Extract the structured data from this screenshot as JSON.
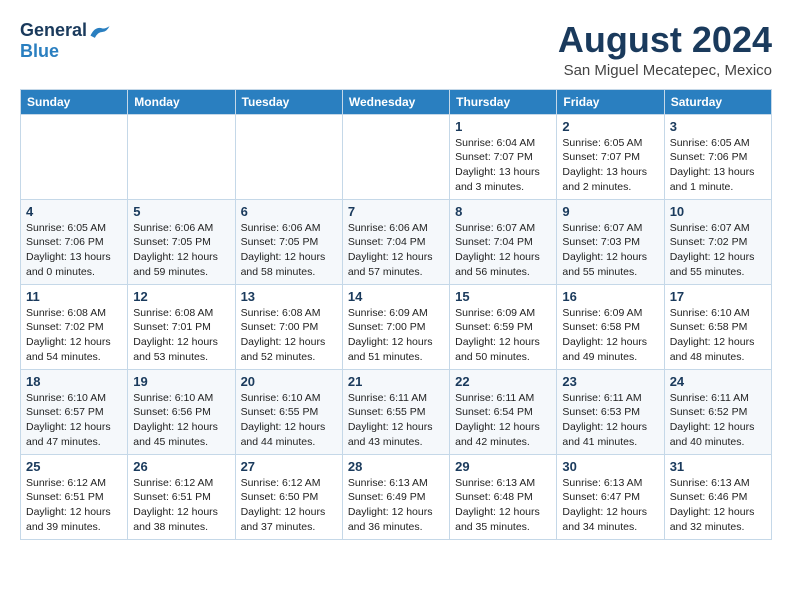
{
  "header": {
    "logo_general": "General",
    "logo_blue": "Blue",
    "month_year": "August 2024",
    "location": "San Miguel Mecatepec, Mexico"
  },
  "weekdays": [
    "Sunday",
    "Monday",
    "Tuesday",
    "Wednesday",
    "Thursday",
    "Friday",
    "Saturday"
  ],
  "weeks": [
    [
      {
        "day": "",
        "info": ""
      },
      {
        "day": "",
        "info": ""
      },
      {
        "day": "",
        "info": ""
      },
      {
        "day": "",
        "info": ""
      },
      {
        "day": "1",
        "info": "Sunrise: 6:04 AM\nSunset: 7:07 PM\nDaylight: 13 hours\nand 3 minutes."
      },
      {
        "day": "2",
        "info": "Sunrise: 6:05 AM\nSunset: 7:07 PM\nDaylight: 13 hours\nand 2 minutes."
      },
      {
        "day": "3",
        "info": "Sunrise: 6:05 AM\nSunset: 7:06 PM\nDaylight: 13 hours\nand 1 minute."
      }
    ],
    [
      {
        "day": "4",
        "info": "Sunrise: 6:05 AM\nSunset: 7:06 PM\nDaylight: 13 hours\nand 0 minutes."
      },
      {
        "day": "5",
        "info": "Sunrise: 6:06 AM\nSunset: 7:05 PM\nDaylight: 12 hours\nand 59 minutes."
      },
      {
        "day": "6",
        "info": "Sunrise: 6:06 AM\nSunset: 7:05 PM\nDaylight: 12 hours\nand 58 minutes."
      },
      {
        "day": "7",
        "info": "Sunrise: 6:06 AM\nSunset: 7:04 PM\nDaylight: 12 hours\nand 57 minutes."
      },
      {
        "day": "8",
        "info": "Sunrise: 6:07 AM\nSunset: 7:04 PM\nDaylight: 12 hours\nand 56 minutes."
      },
      {
        "day": "9",
        "info": "Sunrise: 6:07 AM\nSunset: 7:03 PM\nDaylight: 12 hours\nand 55 minutes."
      },
      {
        "day": "10",
        "info": "Sunrise: 6:07 AM\nSunset: 7:02 PM\nDaylight: 12 hours\nand 55 minutes."
      }
    ],
    [
      {
        "day": "11",
        "info": "Sunrise: 6:08 AM\nSunset: 7:02 PM\nDaylight: 12 hours\nand 54 minutes."
      },
      {
        "day": "12",
        "info": "Sunrise: 6:08 AM\nSunset: 7:01 PM\nDaylight: 12 hours\nand 53 minutes."
      },
      {
        "day": "13",
        "info": "Sunrise: 6:08 AM\nSunset: 7:00 PM\nDaylight: 12 hours\nand 52 minutes."
      },
      {
        "day": "14",
        "info": "Sunrise: 6:09 AM\nSunset: 7:00 PM\nDaylight: 12 hours\nand 51 minutes."
      },
      {
        "day": "15",
        "info": "Sunrise: 6:09 AM\nSunset: 6:59 PM\nDaylight: 12 hours\nand 50 minutes."
      },
      {
        "day": "16",
        "info": "Sunrise: 6:09 AM\nSunset: 6:58 PM\nDaylight: 12 hours\nand 49 minutes."
      },
      {
        "day": "17",
        "info": "Sunrise: 6:10 AM\nSunset: 6:58 PM\nDaylight: 12 hours\nand 48 minutes."
      }
    ],
    [
      {
        "day": "18",
        "info": "Sunrise: 6:10 AM\nSunset: 6:57 PM\nDaylight: 12 hours\nand 47 minutes."
      },
      {
        "day": "19",
        "info": "Sunrise: 6:10 AM\nSunset: 6:56 PM\nDaylight: 12 hours\nand 45 minutes."
      },
      {
        "day": "20",
        "info": "Sunrise: 6:10 AM\nSunset: 6:55 PM\nDaylight: 12 hours\nand 44 minutes."
      },
      {
        "day": "21",
        "info": "Sunrise: 6:11 AM\nSunset: 6:55 PM\nDaylight: 12 hours\nand 43 minutes."
      },
      {
        "day": "22",
        "info": "Sunrise: 6:11 AM\nSunset: 6:54 PM\nDaylight: 12 hours\nand 42 minutes."
      },
      {
        "day": "23",
        "info": "Sunrise: 6:11 AM\nSunset: 6:53 PM\nDaylight: 12 hours\nand 41 minutes."
      },
      {
        "day": "24",
        "info": "Sunrise: 6:11 AM\nSunset: 6:52 PM\nDaylight: 12 hours\nand 40 minutes."
      }
    ],
    [
      {
        "day": "25",
        "info": "Sunrise: 6:12 AM\nSunset: 6:51 PM\nDaylight: 12 hours\nand 39 minutes."
      },
      {
        "day": "26",
        "info": "Sunrise: 6:12 AM\nSunset: 6:51 PM\nDaylight: 12 hours\nand 38 minutes."
      },
      {
        "day": "27",
        "info": "Sunrise: 6:12 AM\nSunset: 6:50 PM\nDaylight: 12 hours\nand 37 minutes."
      },
      {
        "day": "28",
        "info": "Sunrise: 6:13 AM\nSunset: 6:49 PM\nDaylight: 12 hours\nand 36 minutes."
      },
      {
        "day": "29",
        "info": "Sunrise: 6:13 AM\nSunset: 6:48 PM\nDaylight: 12 hours\nand 35 minutes."
      },
      {
        "day": "30",
        "info": "Sunrise: 6:13 AM\nSunset: 6:47 PM\nDaylight: 12 hours\nand 34 minutes."
      },
      {
        "day": "31",
        "info": "Sunrise: 6:13 AM\nSunset: 6:46 PM\nDaylight: 12 hours\nand 32 minutes."
      }
    ]
  ]
}
